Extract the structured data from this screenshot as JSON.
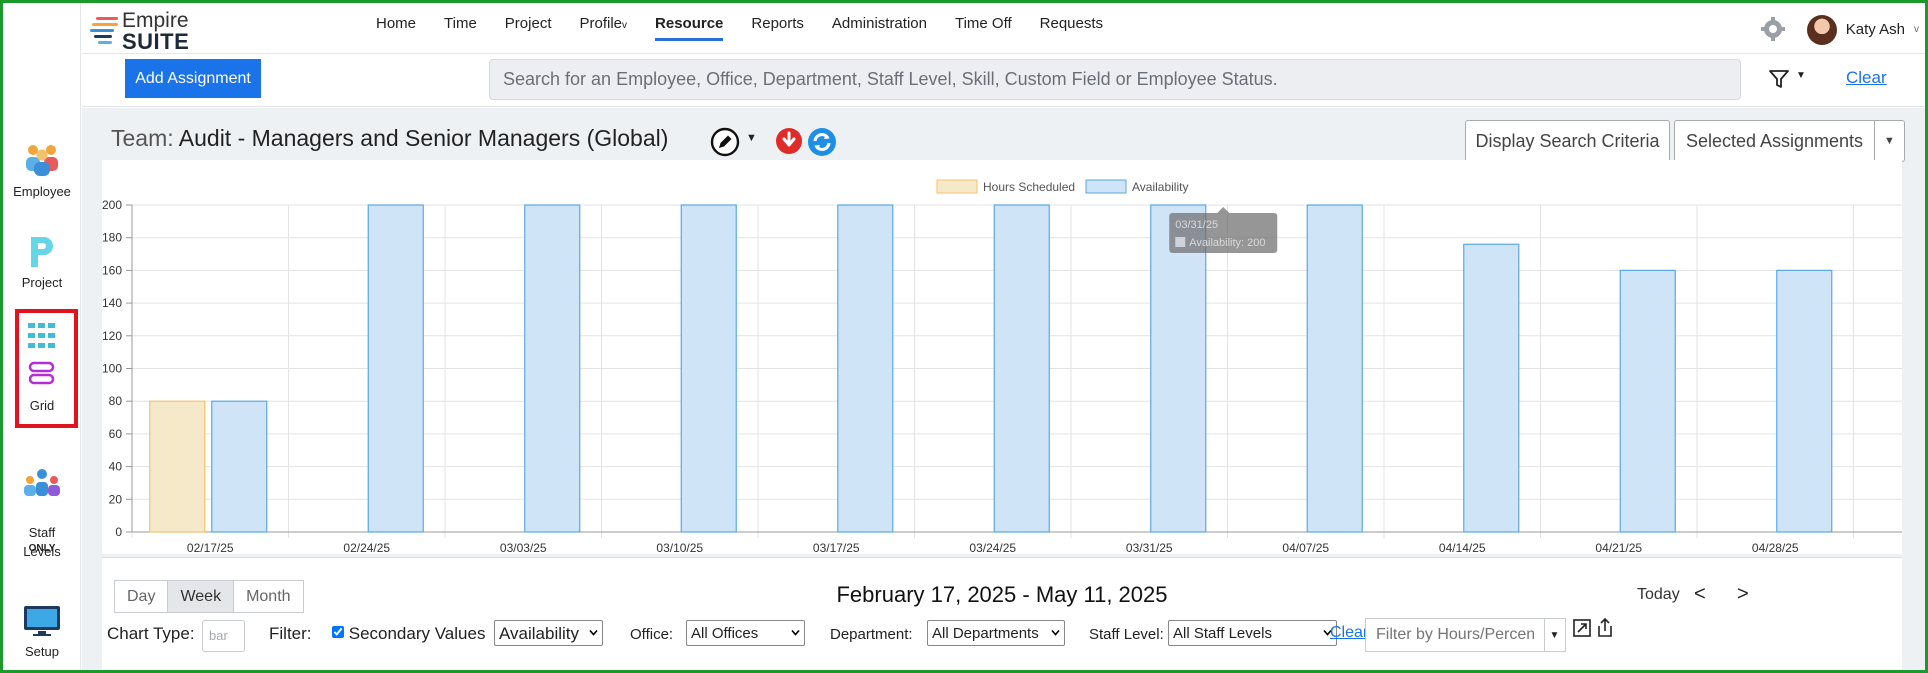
{
  "brand": {
    "name_top": "Empire",
    "name_bottom": "SUITE"
  },
  "nav": {
    "items": [
      {
        "label": "Home",
        "active": false
      },
      {
        "label": "Time",
        "active": false
      },
      {
        "label": "Project",
        "active": false
      },
      {
        "label": "Profile",
        "active": false,
        "caret": "v"
      },
      {
        "label": "Resource",
        "active": true
      },
      {
        "label": "Reports",
        "active": false
      },
      {
        "label": "Administration",
        "active": false
      },
      {
        "label": "Time Off",
        "active": false
      },
      {
        "label": "Requests",
        "active": false
      }
    ],
    "user_name": "Katy Ash",
    "user_caret": "v"
  },
  "sidebar": {
    "items": [
      {
        "label": "Employee",
        "icon": "employee-group-icon",
        "selected": false
      },
      {
        "label": "Project",
        "icon": "project-p-icon",
        "selected": false
      },
      {
        "label": "Grid",
        "icon": "grid-icon",
        "selected": true
      },
      {
        "label": "Staff\nLevels",
        "icon": "staff-levels-icon",
        "selected": false
      },
      {
        "label": "Setup",
        "icon": "monitor-icon",
        "selected": false
      }
    ],
    "badge": "ONLY"
  },
  "toolbar": {
    "add_assignment": "Add Assignment",
    "search_placeholder": "Search for an Employee, Office, Department, Staff Level, Skill, Custom Field or Employee Status.",
    "clear": "Clear"
  },
  "team": {
    "label": "Team:",
    "name": "Audit - Managers and Senior Managers (Global)",
    "display_search_criteria": "Display Search Criteria",
    "selected_assignments": "Selected Assignments"
  },
  "chart_data": {
    "type": "bar",
    "categories": [
      "02/17/25",
      "02/24/25",
      "03/03/25",
      "03/10/25",
      "03/17/25",
      "03/24/25",
      "03/31/25",
      "04/07/25",
      "04/14/25",
      "04/21/25",
      "04/28/25"
    ],
    "series": [
      {
        "name": "Hours Scheduled",
        "values": [
          80,
          0,
          0,
          0,
          0,
          0,
          0,
          0,
          0,
          0,
          0
        ],
        "color": "#f6e9c9",
        "border": "#f5c26b"
      },
      {
        "name": "Availability",
        "values": [
          80,
          200,
          200,
          200,
          200,
          200,
          200,
          200,
          176,
          160,
          160
        ],
        "color": "#cfe4f6",
        "border": "#5aa9e6"
      }
    ],
    "ylim": [
      0,
      200
    ],
    "yticks": [
      0,
      20,
      40,
      60,
      80,
      100,
      120,
      140,
      160,
      180,
      200
    ],
    "grid": true,
    "legend_position": "top-center",
    "tooltip": {
      "title": "03/31/25",
      "text": "Availability: 200"
    }
  },
  "controls": {
    "views": [
      "Day",
      "Week",
      "Month"
    ],
    "selected_view": "Week",
    "date_range": "February 17, 2025 - May 11, 2025",
    "today": "Today",
    "prev": "<",
    "next": ">",
    "chart_type_label": "Chart Type:",
    "chart_type_value": "bar",
    "filter_label": "Filter:",
    "secondary_values_label": "Secondary Values",
    "secondary_values_checked": true,
    "secondary_values_select": "Availability",
    "office_label": "Office:",
    "office_value": "All Offices",
    "department_label": "Department:",
    "department_value": "All Departments",
    "staff_level_label": "Staff Level:",
    "staff_level_value": "All Staff Levels",
    "clear": "Clear",
    "hours_filter_placeholder": "Filter by Hours/Percent"
  }
}
